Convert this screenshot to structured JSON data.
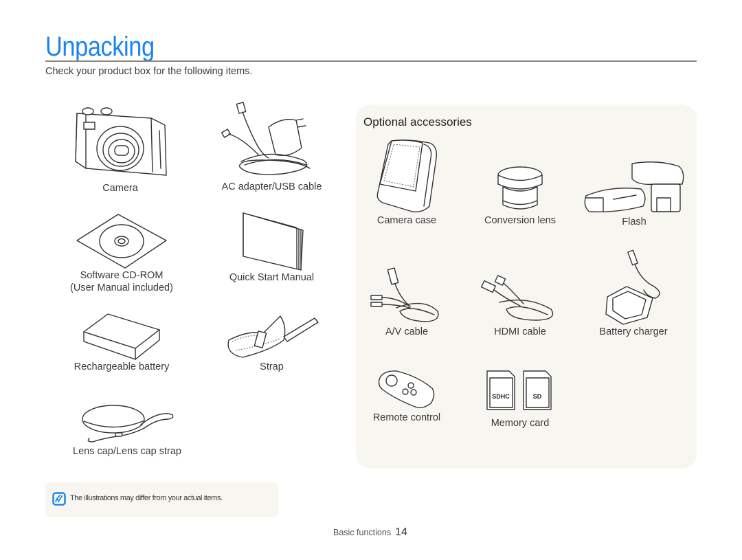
{
  "page": {
    "title": "Unpacking",
    "intro": "Check your product box for the following items.",
    "accent_color": "#1b84f0"
  },
  "included_items": [
    {
      "label": "Camera",
      "icon": "camera-icon"
    },
    {
      "label": "AC adapter/USB cable",
      "icon": "ac-adapter-icon"
    },
    {
      "label": "Software CD-ROM",
      "label2": "(User Manual included)",
      "icon": "cd-rom-icon"
    },
    {
      "label": "Quick Start Manual",
      "icon": "manual-icon"
    },
    {
      "label": "Rechargeable battery",
      "icon": "battery-icon"
    },
    {
      "label": "Strap",
      "icon": "strap-icon"
    },
    {
      "label": "Lens cap/Lens cap strap",
      "icon": "lens-cap-icon"
    }
  ],
  "optional": {
    "title": "Optional accessories",
    "items": [
      {
        "label": "Camera case",
        "icon": "camera-case-icon"
      },
      {
        "label": "Conversion lens",
        "icon": "conversion-lens-icon"
      },
      {
        "label": "Flash",
        "icon": "flash-icon"
      },
      {
        "label": "A/V cable",
        "icon": "av-cable-icon"
      },
      {
        "label": "HDMI cable",
        "icon": "hdmi-cable-icon"
      },
      {
        "label": "Battery charger",
        "icon": "battery-charger-icon"
      },
      {
        "label": "Remote control",
        "icon": "remote-control-icon"
      },
      {
        "label": "Memory card",
        "icon": "memory-card-icon",
        "card_labels": [
          "SDHC",
          "SD"
        ]
      }
    ]
  },
  "note": {
    "icon": "note-pencil-icon",
    "text": "The illustrations may differ from your actual items."
  },
  "footer": {
    "section": "Basic functions",
    "page_number": "14"
  }
}
